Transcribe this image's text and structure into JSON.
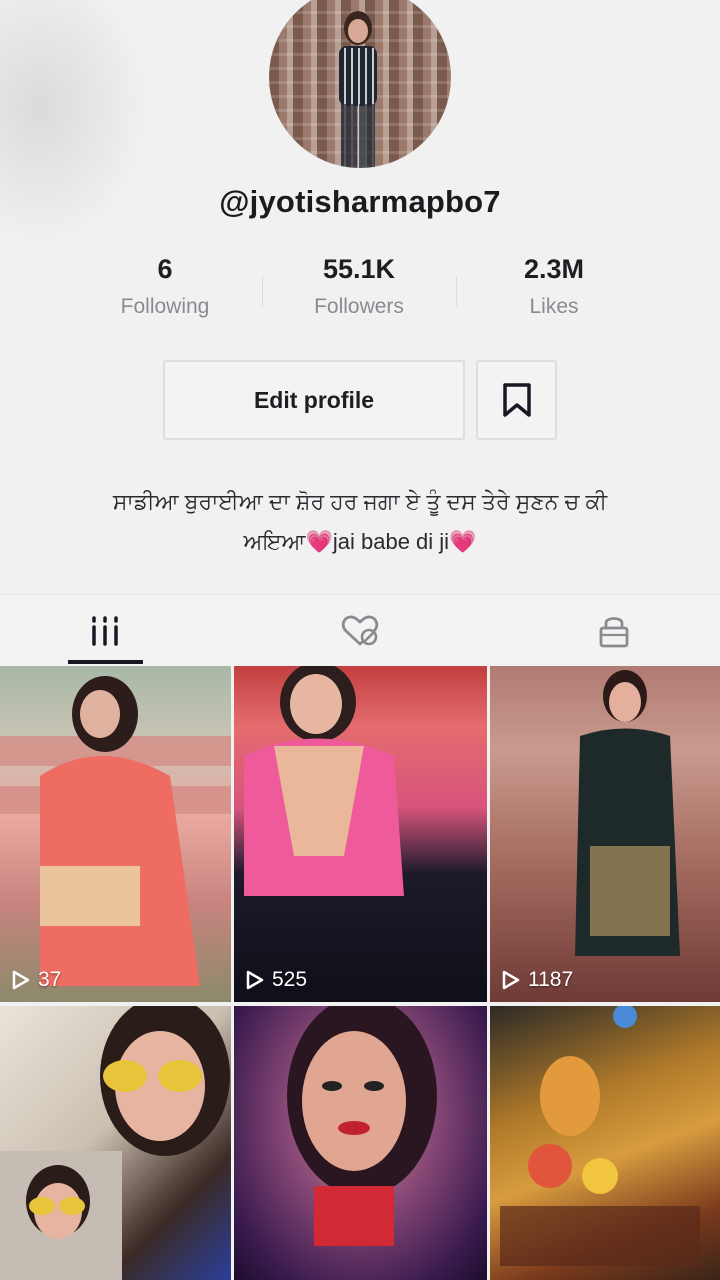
{
  "profile": {
    "username": "@jyotisharmapbo7",
    "stats": [
      {
        "value": "6",
        "label": "Following"
      },
      {
        "value": "55.1K",
        "label": "Followers"
      },
      {
        "value": "2.3M",
        "label": "Likes"
      }
    ],
    "edit_button": "Edit profile",
    "bio_line1": "ਸਾਡੀਆ ਬੁਰਾਈਆ ਦਾ ਸ਼ੋਰ ਹਰ ਜਗਾ ਏ ਤੂੰ ਦਸ ਤੇਰੇ ਸੁਣਨ ਚ ਕੀ",
    "bio_line2": "ਅਇਆ💗jai babe di ji💗"
  },
  "tabs": [
    {
      "icon": "grid-icon",
      "active": true
    },
    {
      "icon": "liked-heart-icon",
      "active": false
    },
    {
      "icon": "lock-icon",
      "active": false
    }
  ],
  "videos": [
    {
      "views": "37"
    },
    {
      "views": "525"
    },
    {
      "views": "1187"
    },
    {
      "views": ""
    },
    {
      "views": ""
    },
    {
      "views": ""
    }
  ],
  "colors": {
    "background": "#f1f1f1",
    "text_primary": "#161823",
    "text_secondary": "#8a8b91",
    "border": "#dedede"
  }
}
